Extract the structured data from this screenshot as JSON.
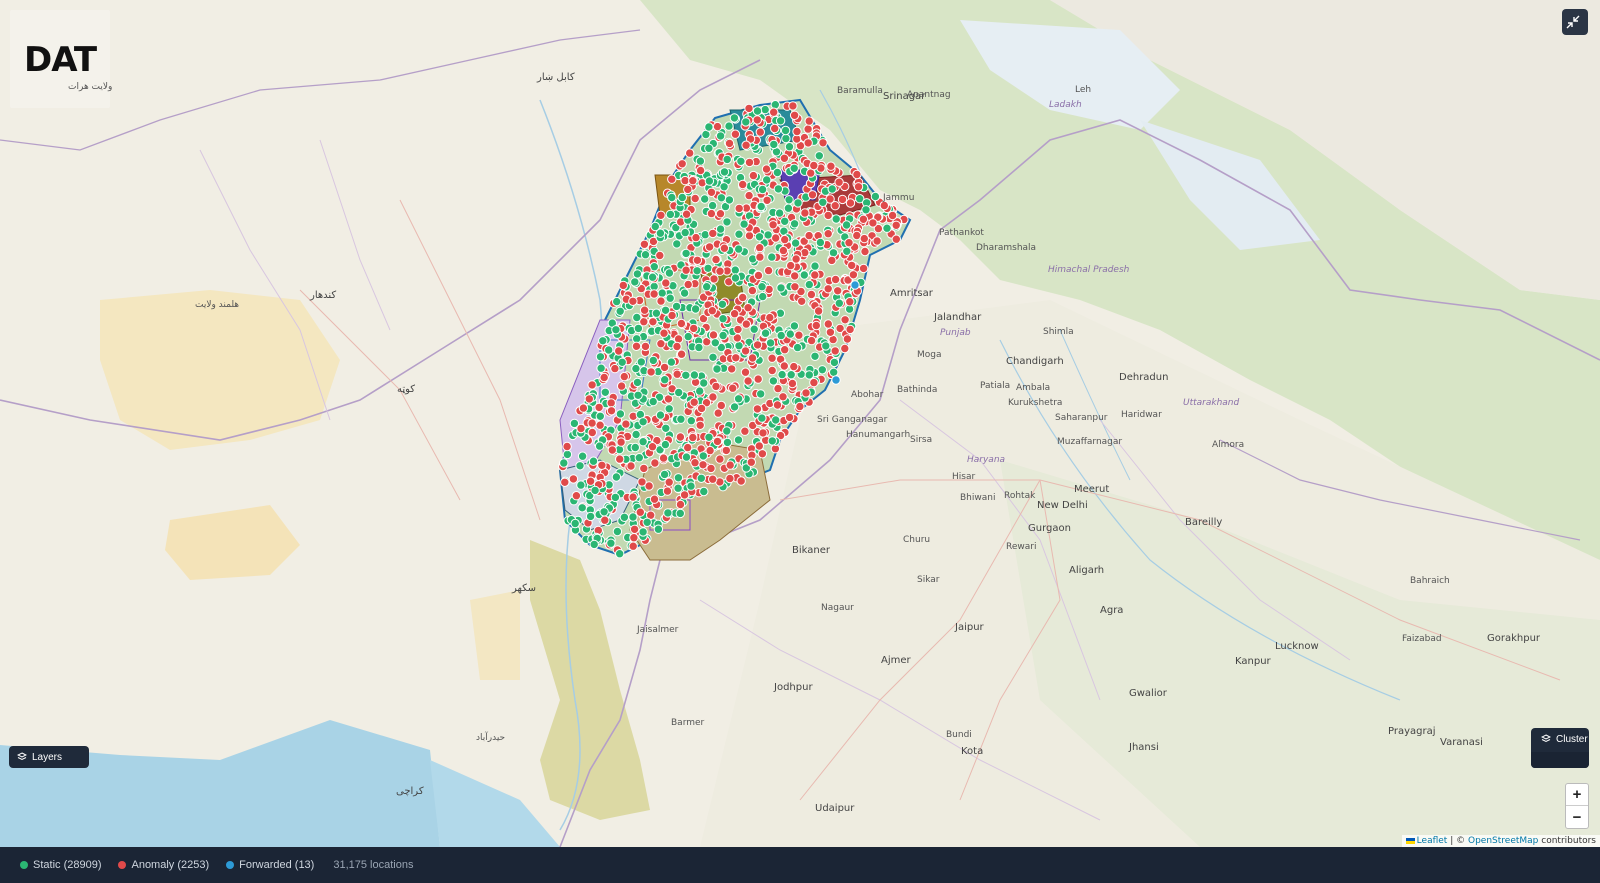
{
  "brand": {
    "logo_text": "DAT",
    "logo_subtitle": "ولایت هرات"
  },
  "controls": {
    "fullscreen_icon": "collapse-arrows-icon",
    "layers_label": "Layers",
    "cluster_label": "Cluster",
    "zoom_in": "+",
    "zoom_out": "−"
  },
  "attribution": {
    "leaflet": "Leaflet",
    "separator": "|",
    "copyright": "©",
    "osm": "OpenStreetMap",
    "contributors": "contributors"
  },
  "status": {
    "static_label": "Static (28909)",
    "anomaly_label": "Anomaly (2253)",
    "forwarded_label": "Forwarded (13)",
    "locations_label": "31,175 locations"
  },
  "colors": {
    "static": "#2bb673",
    "anomaly": "#e04a4a",
    "forwarded": "#2d9ad6",
    "status_bar": "#1b2535"
  },
  "map_labels": {
    "srinagar": "Srinagar",
    "jammu": "Jammu",
    "pathankot": "Pathankot",
    "amritsar": "Amritsar",
    "jalandhar": "Jalandhar",
    "ludhiana_region": "Punjab",
    "chandigarh": "Chandigarh",
    "dehradun": "Dehradun",
    "shimla": "Shimla",
    "kurukshetra": "Kurukshetra",
    "saharanpur": "Saharanpur",
    "muzaffarnagar": "Muzaffarnagar",
    "meerut": "Meerut",
    "new_delhi": "New Delhi",
    "gurgaon": "Gurgaon",
    "rewari": "Rewari",
    "aligarh": "Aligarh",
    "agra": "Agra",
    "bareilly": "Bareilly",
    "lucknow": "Lucknow",
    "kanpur": "Kanpur",
    "gwalior": "Gwalior",
    "jaipur": "Jaipur",
    "ajmer": "Ajmer",
    "jodhpur": "Jodhpur",
    "bikaner": "Bikaner",
    "jaisalmer": "Jaisalmer",
    "nagaur": "Nagaur",
    "udaipur": "Udaipur",
    "kota": "Kota",
    "barmer": "Barmer",
    "hisar": "Hisar",
    "bhiwani": "Bhiwani",
    "rohtak": "Rohtak",
    "sirsa": "Sirsa",
    "bathinda": "Bathinda",
    "moga": "Moga",
    "sri_ganganagar": "Sri Ganganagar",
    "hanumangarh": "Hanumangarh",
    "abohar": "Abohar",
    "patiala": "Patiala",
    "ambala": "Ambala",
    "haridwar": "Haridwar",
    "almora": "Almora",
    "prayagraj": "Prayagraj",
    "varanasi": "Varanasi",
    "gorakhpur": "Gorakhpur",
    "haryana": "Haryana",
    "uttarakhand": "Uttarakhand",
    "himachal": "Himachal Pradesh",
    "ladakh": "Ladakh",
    "leh": "Leh",
    "jhansi": "Jhansi",
    "bundi": "Bundi",
    "sikar": "Sikar",
    "churu": "Churu",
    "kabul": "کابل ښار",
    "kandahar": "کندهار",
    "quetta": "کوټه",
    "karachi": "کراچی",
    "helmand": "هلمند ولایت",
    "sukkur": "سکھر",
    "hyderabad": "حیدرآباد",
    "baramulla": "Baramulla",
    "anantnag": "Anantnag",
    "dharamshala": "Dharamshala",
    "faizabad": "Faizabad",
    "bahraich": "Bahraich"
  }
}
